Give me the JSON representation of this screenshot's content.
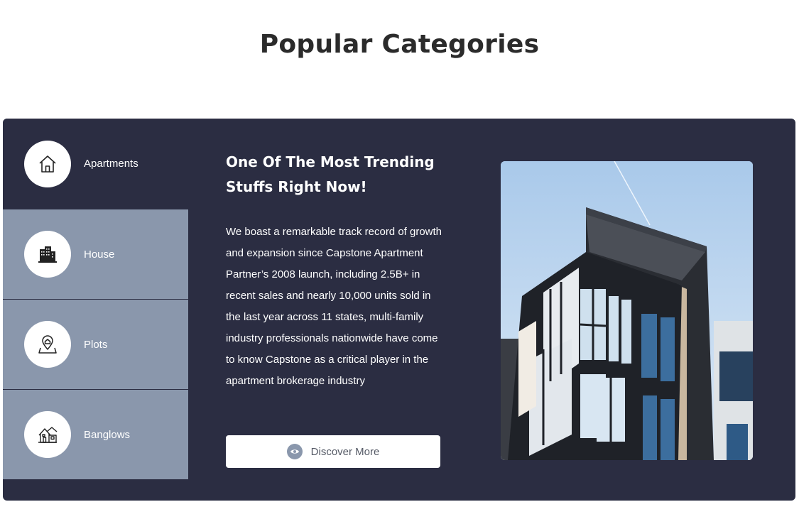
{
  "page": {
    "title": "Popular Categories"
  },
  "categories": [
    {
      "label": "Apartments",
      "icon": "home-icon",
      "active": true
    },
    {
      "label": "House",
      "icon": "buildings-icon",
      "active": false
    },
    {
      "label": "Plots",
      "icon": "location-pin-icon",
      "active": false
    },
    {
      "label": "Banglows",
      "icon": "bungalow-icon",
      "active": false
    }
  ],
  "content": {
    "headline": "One Of The Most Trending Stuffs Right Now!",
    "body": "We boast a remarkable track record of growth and expansion since Capstone Apartment Partner’s 2008 launch, including 2.5B+ in recent sales and nearly 10,000 units sold in the last year across 11 states, multi-family industry professionals nationwide have come to know Capstone as a critical player in the apartment brokerage industry",
    "button_label": "Discover More",
    "button_icon": "eye-icon"
  },
  "colors": {
    "panel_bg": "#2b2d42",
    "inactive_tab_bg": "#8a97ac",
    "text_light": "#ffffff",
    "title_text": "#2b2b2b"
  }
}
